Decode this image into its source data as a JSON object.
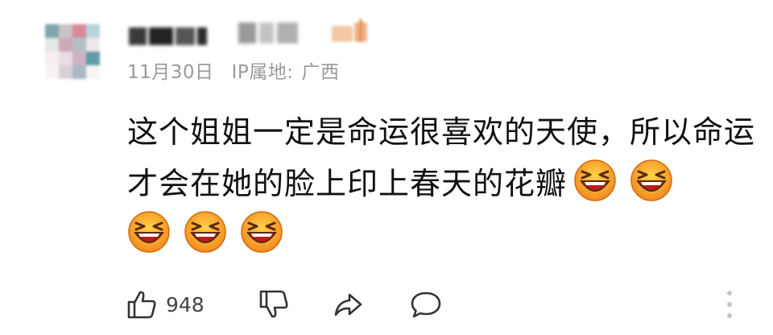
{
  "comment": {
    "date": "11月30日",
    "ip_label": "IP属地:",
    "ip_location": "广西",
    "text_part1": "这个姐姐一定是命运很喜欢的天使，所以命运才会在她的脸上印上春天的花瓣",
    "emojis": [
      "laughing-face-emoji",
      "laughing-face-emoji",
      "laughing-face-emoji",
      "laughing-face-emoji",
      "laughing-face-emoji"
    ]
  },
  "actions": {
    "like_count": "948",
    "icons": [
      "thumbs-up-icon",
      "thumbs-down-icon",
      "share-icon",
      "reply-icon",
      "more-icon"
    ]
  },
  "colors": {
    "meta_text": "#9a9a9a",
    "body_text": "#111111",
    "icon": "#333333"
  }
}
